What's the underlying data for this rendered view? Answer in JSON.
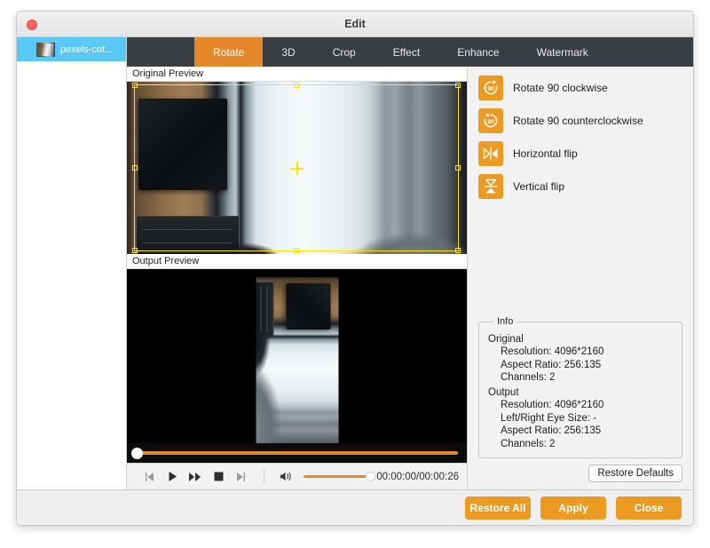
{
  "window": {
    "title": "Edit",
    "close_button": "close"
  },
  "sidebar": {
    "files": [
      {
        "name": "pexels-cot...",
        "selected": true
      }
    ]
  },
  "tabs": [
    {
      "label": "Rotate",
      "active": true
    },
    {
      "label": "3D",
      "active": false
    },
    {
      "label": "Crop",
      "active": false
    },
    {
      "label": "Effect",
      "active": false
    },
    {
      "label": "Enhance",
      "active": false
    },
    {
      "label": "Watermark",
      "active": false
    }
  ],
  "preview": {
    "original_label": "Original Preview",
    "output_label": "Output Preview"
  },
  "operations": [
    {
      "label": "Rotate 90 clockwise",
      "icon": "rotate-cw-90-icon"
    },
    {
      "label": "Rotate 90 counterclockwise",
      "icon": "rotate-ccw-90-icon"
    },
    {
      "label": "Horizontal flip",
      "icon": "flip-horizontal-icon"
    },
    {
      "label": "Vertical flip",
      "icon": "flip-vertical-icon"
    }
  ],
  "transport": {
    "previous": "previous-icon",
    "play": "play-icon",
    "forward": "fast-forward-icon",
    "stop": "stop-icon",
    "next": "next-icon",
    "volume_icon": "volume-icon",
    "volume_level": 100,
    "time": "00:00:00/00:00:26",
    "progress": 0
  },
  "info": {
    "legend": "Info",
    "original_head": "Original",
    "original": [
      "Resolution: 4096*2160",
      "Aspect Ratio: 256:135",
      "Channels: 2"
    ],
    "output_head": "Output",
    "output": [
      "Resolution: 4096*2160",
      "Left/Right Eye Size: -",
      "Aspect Ratio: 256:135",
      "Channels: 2"
    ],
    "restore_defaults": "Restore Defaults"
  },
  "footer": {
    "restore_all": "Restore All",
    "apply": "Apply",
    "close": "Close"
  },
  "colors": {
    "accent_orange": "#eb9a22",
    "tab_active": "#e5882b",
    "tab_bar": "#3a3d41",
    "sidebar_selected": "#5ac8f5",
    "crop_outline": "#ffe600"
  }
}
